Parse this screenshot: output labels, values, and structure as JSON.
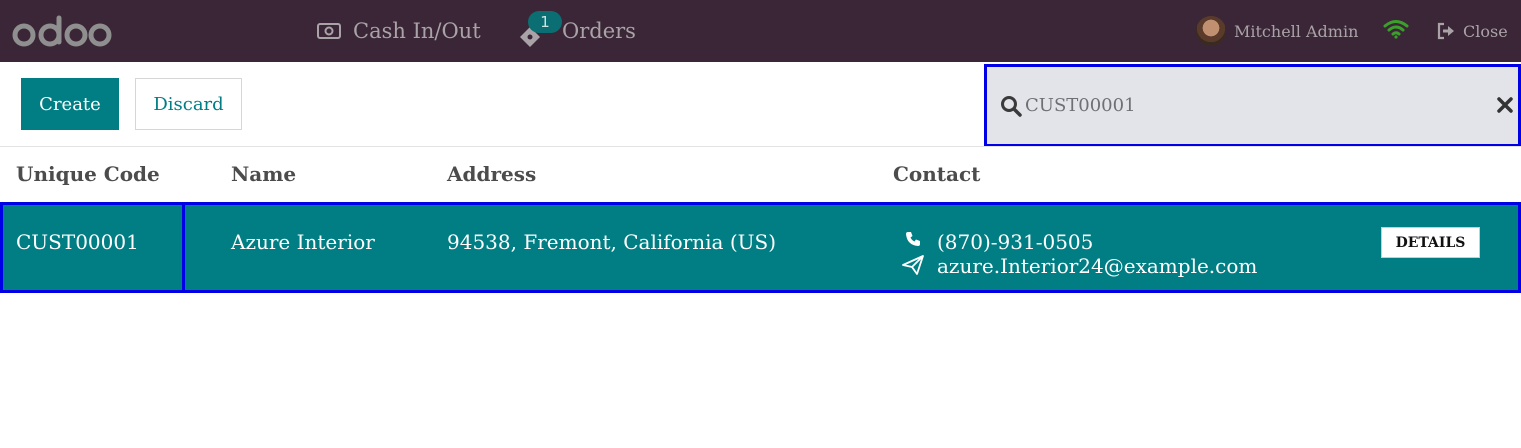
{
  "topbar": {
    "logo_text": "odoo",
    "nav": [
      {
        "label": "Cash In/Out",
        "icon": "money-icon"
      },
      {
        "label": "Orders",
        "icon": "ticket-icon",
        "badge": "1"
      }
    ],
    "user_name": "Mitchell Admin",
    "wifi_icon": "wifi-icon",
    "close_label": "Close"
  },
  "controls": {
    "create_label": "Create",
    "discard_label": "Discard"
  },
  "search": {
    "value": "CUST00001",
    "icon": "search-icon",
    "clear_icon": "close-icon"
  },
  "table": {
    "columns": [
      "Unique Code",
      "Name",
      "Address",
      "Contact"
    ],
    "rows": [
      {
        "code": "CUST00001",
        "name": "Azure Interior",
        "address": "94538, Fremont, California (US)",
        "phone": "(870)-931-0505",
        "email": "azure.Interior24@example.com",
        "action_label": "DETAILS"
      }
    ]
  },
  "colors": {
    "topbar": "#3a2636",
    "accent": "#017e84",
    "highlight_border": "#0000e6",
    "search_bg": "#e3e4ea"
  }
}
